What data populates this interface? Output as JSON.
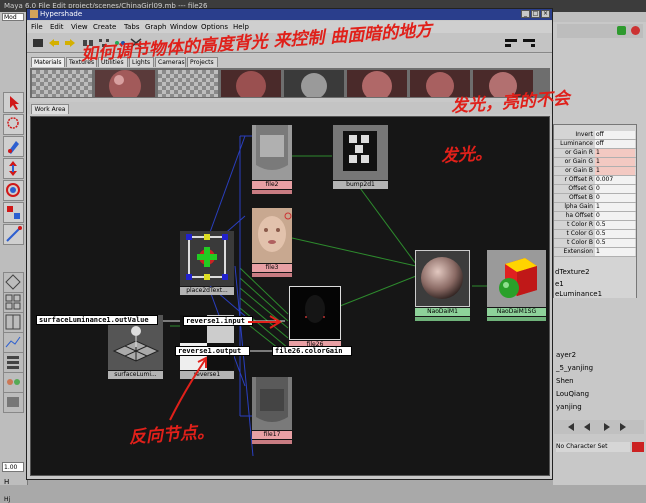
{
  "maya": {
    "title": "Maya 6.0  File  Edit  project/scenes/ChinaGirl09.mb  ---  file26",
    "mode_field": "Mod",
    "bottom_field": "1.00",
    "bottom_letter": "H",
    "character_set": "No Character Set",
    "lower_label": "Hj"
  },
  "hypershade": {
    "title": "Hypershade",
    "menu": [
      "File",
      "Edit",
      "View",
      "Create",
      "Tabs",
      "Graph",
      "Window",
      "Options",
      "Help"
    ],
    "tabs": [
      "Materials",
      "Textures",
      "Utilities",
      "Lights",
      "Cameras",
      "Projects"
    ],
    "work_area_tab": "Work Area"
  },
  "nodes": {
    "file2": "file2",
    "bump2d1": "bump2d1",
    "file3": "file3",
    "place2d": "place2dText...",
    "file26": "file26",
    "naodaim1": "NaoDaiM1",
    "naodaim1sg": "NaoDaiM1SG",
    "surfacelumi": "surfaceLumi...",
    "reverse1": "reverse1",
    "file17": "file17"
  },
  "connections": {
    "surface_out": "surfaceLuminance1.outValue",
    "reverse_input": "reverse1.input",
    "reverse_output": "reverse1.output",
    "file26_colorgain": "file26.colorGain"
  },
  "attributes": [
    {
      "label": "Invert",
      "value": "off",
      "pink": false
    },
    {
      "label": "Luminance",
      "value": "off",
      "pink": false
    },
    {
      "label": "or Gain R",
      "value": "1",
      "pink": true
    },
    {
      "label": "or Gain G",
      "value": "1",
      "pink": true
    },
    {
      "label": "or Gain B",
      "value": "1",
      "pink": true
    },
    {
      "label": "r Offset R",
      "value": "0.007",
      "pink": false
    },
    {
      "label": "Offset G",
      "value": "0",
      "pink": false
    },
    {
      "label": "Offset B",
      "value": "0",
      "pink": false
    },
    {
      "label": "lpha Gain",
      "value": "1",
      "pink": false
    },
    {
      "label": "ha Offset",
      "value": "0",
      "pink": false
    },
    {
      "label": "t Color R",
      "value": "0.5",
      "pink": false
    },
    {
      "label": "t Color G",
      "value": "0.5",
      "pink": false
    },
    {
      "label": "t Color B",
      "value": "0.5",
      "pink": false
    },
    {
      "label": "Extension",
      "value": "1",
      "pink": false
    }
  ],
  "right_panel": {
    "line1": "dTexture2",
    "line2": "e1",
    "line3": "eLuminance1",
    "tions": "tions"
  },
  "channel_items": [
    "ayer2",
    "_5_yanjing",
    "Shen",
    "LouQiang",
    "yanjing"
  ],
  "annotations": {
    "top_line": "如何调节物体的高度背光 来控制 曲面暗的地方",
    "mid_line": "发光，亮的不会",
    "low_line": "发光。",
    "bottom": "反向节点。"
  }
}
